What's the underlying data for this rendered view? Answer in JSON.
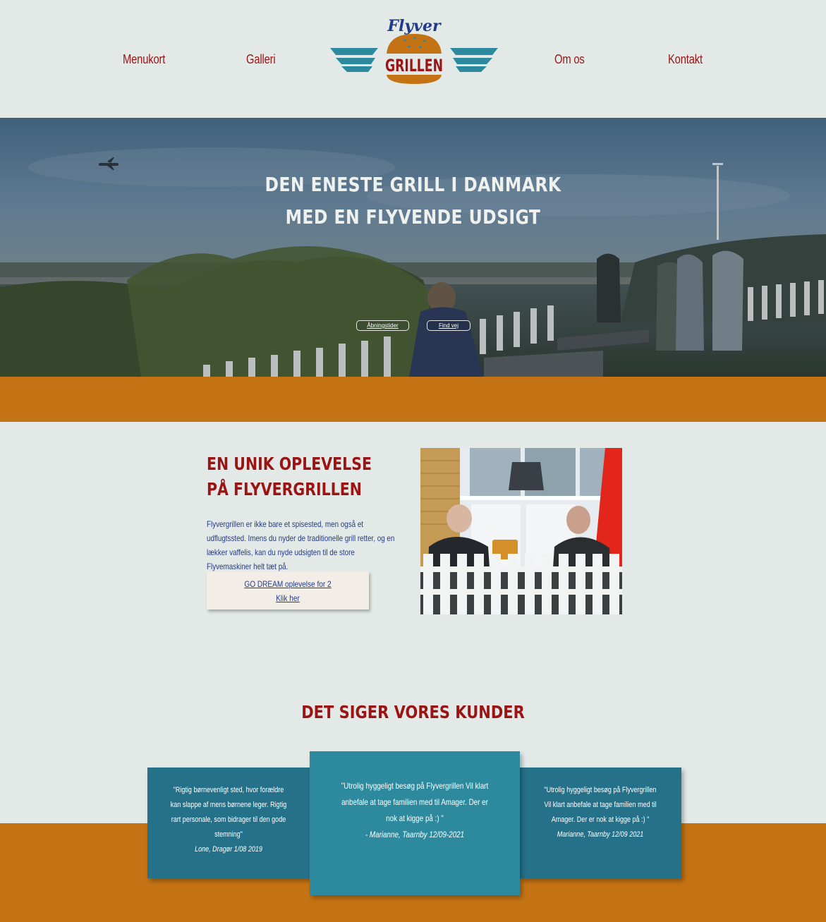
{
  "nav": {
    "items": [
      {
        "label": "Menukort"
      },
      {
        "label": "Galleri"
      },
      {
        "label": "Om os"
      },
      {
        "label": "Kontakt"
      }
    ]
  },
  "logo": {
    "top_text": "Flyver",
    "main_text": "GRILLEN",
    "colors": {
      "wing": "#2d8a9e",
      "bun": "#c47314",
      "text": "#9b1414",
      "script": "#1f3c8c"
    }
  },
  "hero": {
    "title_line1": "DEN ENESTE GRILL I DANMARK",
    "title_line2": "MED EN FLYVENDE UDSIGT",
    "buttons": [
      {
        "label": "Åbningstider"
      },
      {
        "label": "Find vej"
      }
    ]
  },
  "intro": {
    "title": "EN UNIK OPLEVELSE PÅ FLYVERGRILLEN",
    "text": "Flyvergrillen er ikke bare et spisested, men også et udflugtssted. Imens du nyder de traditionelle grill retter, og en lækker vaffelis, kan du nyde udsigten til de store Flyvemaskiner helt tæt på.",
    "cta_line1": "GO DREAM oplevelse for 2",
    "cta_line2": "Klik her"
  },
  "reviews": {
    "title": "DET SIGER VORES KUNDER",
    "items": [
      {
        "quote": "\"Rigtig børnevenligt sted, hvor forældre kan slappe af mens børnene leger. Rigtig rart personale, som bidrager til den gode stemning\"",
        "author": "Lone, Dragør 1/08 2019"
      },
      {
        "quote": "\"Utrolig hyggeligt besøg på Flyvergrillen Vil klart anbefale at tage familien med til Amager. Der er nok at kigge på :) \"",
        "author": "- Marianne, Taarnby 12/09-2021"
      },
      {
        "quote": "\"Utrolig hyggeligt besøg på Flyvergrillen Vil klart anbefale at tage familien med til Amager. Der er nok at kigge på :) \"",
        "author": "Marianne, Taarnby 12/09 2021"
      }
    ]
  },
  "colors": {
    "background": "#e3e9e6",
    "accent_red": "#9b1414",
    "band_orange": "#c47314",
    "card_teal": "#25718a",
    "card_teal_light": "#2d8a9e",
    "text_blue": "#233b8c"
  }
}
